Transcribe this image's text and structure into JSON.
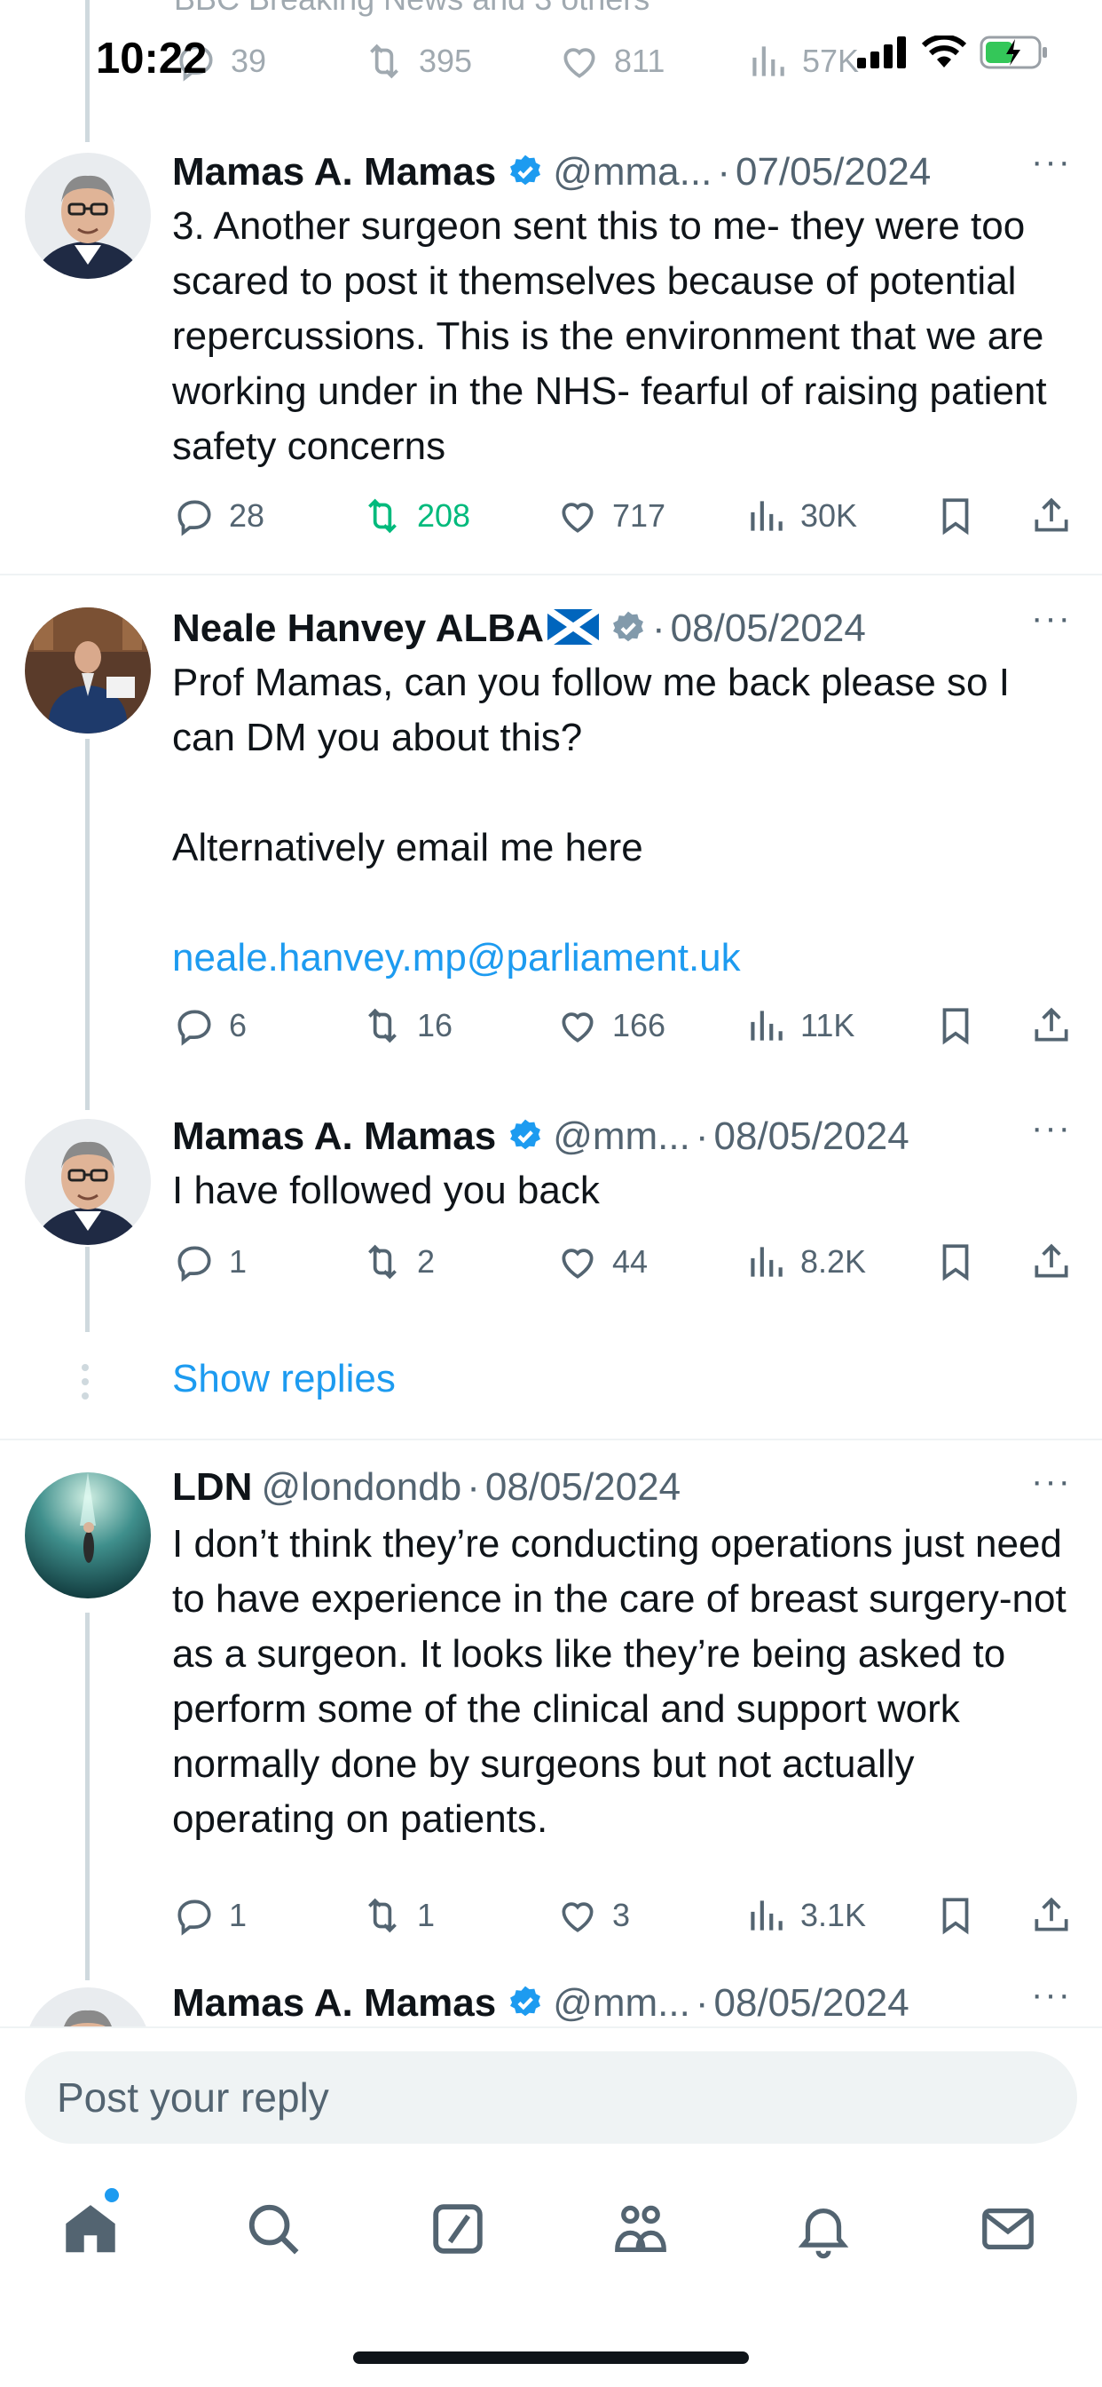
{
  "status_bar": {
    "time": "10:22"
  },
  "top_cut": {
    "text": "BBC Breaking News and 3 others",
    "reply_count": "39",
    "retweet_count": "395",
    "like_count": "811",
    "view_count": "57K"
  },
  "tweets": [
    {
      "name": "Mamas A. Mamas",
      "verified": true,
      "handle": "@mma...",
      "date": "07/05/2024",
      "body": "3. Another surgeon sent this to me- they were too scared to post it themselves because of potential repercussions. This is the environment that we are working under in the NHS- fearful of raising patient safety concerns",
      "replies": "28",
      "retweets": "208",
      "likes": "717",
      "views": "30K"
    },
    {
      "name": "Neale Hanvey ALBA",
      "flag": "🏴",
      "verified": true,
      "date": "08/05/2024",
      "body_line1": "Prof Mamas, can you follow me back please so I can DM you about this?",
      "body_line2": "Alternatively email me here",
      "body_link": "neale.hanvey.mp@parliament.uk",
      "replies": "6",
      "retweets": "16",
      "likes": "166",
      "views": "11K"
    },
    {
      "name": "Mamas A. Mamas",
      "verified": true,
      "handle": "@mm...",
      "date": "08/05/2024",
      "body": "I have followed you back",
      "replies": "1",
      "retweets": "2",
      "likes": "44",
      "views": "8.2K"
    },
    {
      "name": "LDN",
      "verified": false,
      "handle": "@londondb",
      "date": "08/05/2024",
      "body": "I don’t think they’re conducting operations just need to have experience in the care of breast surgery-not as a surgeon. It looks like they’re being asked to perform some of the clinical and support work normally done by surgeons but not actually operating on patients.",
      "replies": "1",
      "retweets": "1",
      "likes": "3",
      "views": "3.1K"
    },
    {
      "name": "Mamas A. Mamas",
      "verified": true,
      "handle": "@mm...",
      "date": "08/05/2024"
    }
  ],
  "show_replies_label": "Show replies",
  "reply_bar": {
    "placeholder": "Post your reply"
  },
  "tab_bar": [
    "home-icon",
    "search-icon",
    "grok-icon",
    "communities-icon",
    "notifications-icon",
    "messages-icon"
  ],
  "colors": {
    "accent": "#1d9bf0",
    "retweet_active": "#00ba7c",
    "secondary_text": "#536471"
  }
}
